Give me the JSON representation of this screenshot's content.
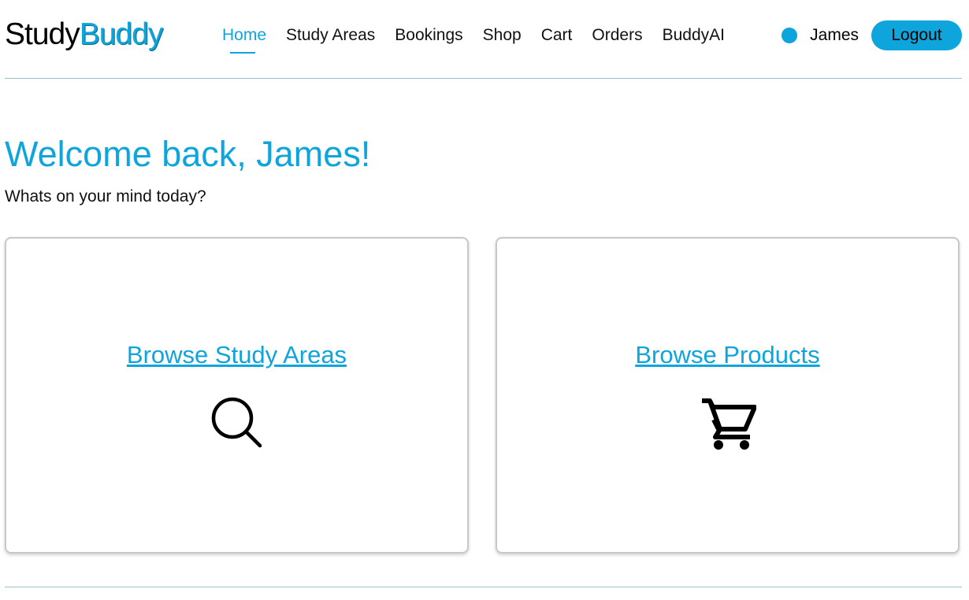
{
  "header": {
    "logo_part1": "Study",
    "logo_part2": "Buddy",
    "nav": [
      {
        "label": "Home",
        "active": true
      },
      {
        "label": "Study Areas"
      },
      {
        "label": "Bookings"
      },
      {
        "label": "Shop"
      },
      {
        "label": "Cart"
      },
      {
        "label": "Orders"
      },
      {
        "label": "BuddyAI"
      }
    ],
    "user_name": "James",
    "logout_label": "Logout"
  },
  "main": {
    "welcome": "Welcome back, James!",
    "subtitle": "Whats on your mind today?",
    "cards": [
      {
        "label": "Browse Study Areas",
        "icon": "search-icon"
      },
      {
        "label": "Browse Products",
        "icon": "cart-icon"
      }
    ]
  },
  "colors": {
    "accent": "#0ea5dc",
    "divider": "#9cc3cc",
    "card_border": "#c8c8c8"
  }
}
